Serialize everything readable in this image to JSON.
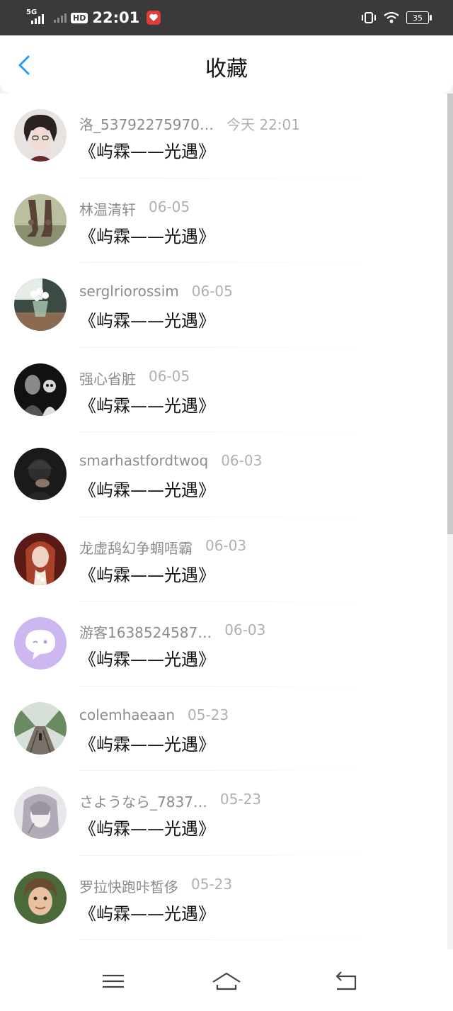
{
  "status_bar": {
    "network": "5G",
    "hd": "HD",
    "time": "22:01",
    "battery": "35"
  },
  "header": {
    "title": "收藏"
  },
  "favorites": [
    {
      "user": "洛_53792275970…",
      "date": "今天 22:01",
      "title": "《屿霖——光遇》"
    },
    {
      "user": "林温清轩",
      "date": "06-05",
      "title": "《屿霖——光遇》"
    },
    {
      "user": "serglriorossim",
      "date": "06-05",
      "title": "《屿霖——光遇》"
    },
    {
      "user": "强心省脏",
      "date": "06-05",
      "title": "《屿霖——光遇》"
    },
    {
      "user": "smarhastfordtwoq",
      "date": "06-03",
      "title": "《屿霖——光遇》"
    },
    {
      "user": "龙虚鸹幻争蜩唔霸",
      "date": "06-03",
      "title": "《屿霖——光遇》"
    },
    {
      "user": "游客1638524587…",
      "date": "06-03",
      "title": "《屿霖——光遇》"
    },
    {
      "user": "colemhaeaan",
      "date": "05-23",
      "title": "《屿霖——光遇》"
    },
    {
      "user": "さようなら_7837…",
      "date": "05-23",
      "title": "《屿霖——光遇》"
    },
    {
      "user": "罗拉快跑咔皙侈",
      "date": "05-23",
      "title": "《屿霖——光遇》"
    }
  ],
  "nav": {
    "icons": [
      "menu-icon",
      "home-icon",
      "back-icon"
    ]
  },
  "colors": {
    "accent": "#2a9df4",
    "status_bar": "#3a3a3a",
    "meta_text": "#8c8c8c",
    "date_text": "#b0b0b0"
  }
}
